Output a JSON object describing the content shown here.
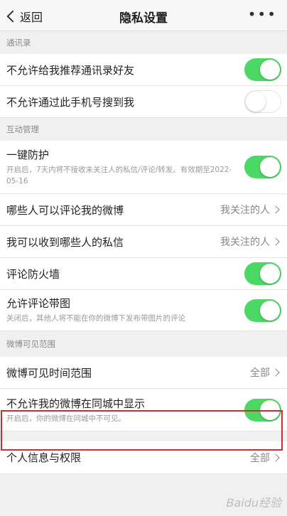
{
  "nav": {
    "back_label": "返回",
    "title": "隐私设置",
    "more_label": "•••"
  },
  "sections": {
    "contacts": {
      "header": "通讯录",
      "rows": [
        {
          "label": "不允许给我推荐通讯录好友",
          "toggle": "on"
        },
        {
          "label": "不允许通过此手机号搜到我",
          "toggle": "off"
        }
      ]
    },
    "interaction": {
      "header": "互动管理",
      "protect": {
        "label": "一键防护",
        "desc": "开启后，7天内将不接收未关注人的私信/评论/转发。有效期至2022-05-16",
        "toggle": "on"
      },
      "comment_who": {
        "label": "哪些人可以评论我的微博",
        "value": "我关注的人"
      },
      "dm_who": {
        "label": "我可以收到哪些人的私信",
        "value": "我关注的人"
      },
      "firewall": {
        "label": "评论防火墙",
        "toggle": "on"
      },
      "img_comment": {
        "label": "允许评论带图",
        "desc": "关闭后，其他人将不能在你的微博下发布带图片的评论",
        "toggle": "on"
      }
    },
    "visibility": {
      "header": "微博可见范围",
      "time_range": {
        "label": "微博可见时间范围",
        "value": "全部"
      },
      "local": {
        "label": "不允许我的微博在同城中显示",
        "desc": "开启后，你的微博在同城中不可见。",
        "toggle": "on"
      }
    },
    "personal": {
      "label": "个人信息与权限",
      "value": "全部"
    }
  },
  "watermark": "Baidu经验",
  "colors": {
    "toggle_on": "#4cd864",
    "highlight": "#e0262c"
  }
}
